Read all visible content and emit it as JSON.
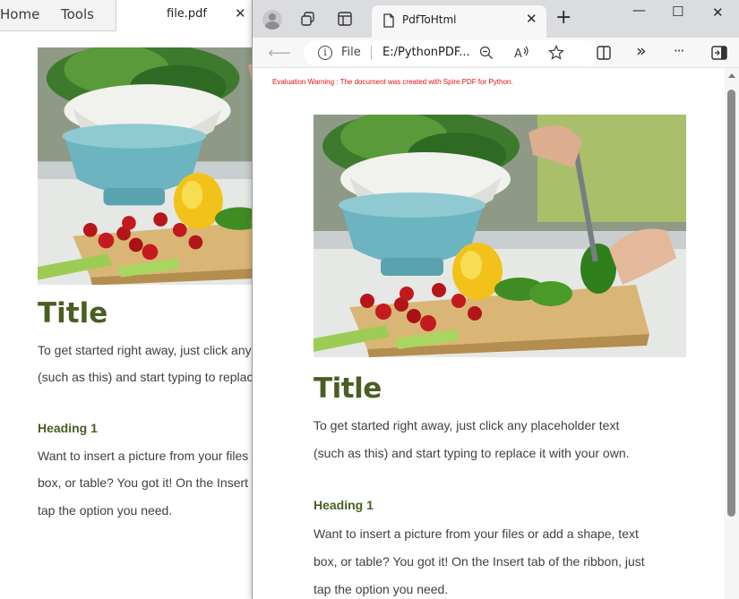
{
  "background_viewer": {
    "tabs": {
      "home": "Home",
      "tools": "Tools"
    },
    "file_tab": {
      "name": "file.pdf",
      "close": "✕"
    },
    "document": {
      "title": "Title",
      "line1": "To get started right away, just click any placeholder text",
      "line2": "(such as this) and start typing to replace it with your own.",
      "heading": "Heading 1",
      "line3": "Want to insert a picture from your files or add a shape, text",
      "line4": "box, or table? You got it! On the Insert tab of the ribbon, just",
      "line5": "tap the option you need."
    }
  },
  "browser": {
    "tab": {
      "title": "PdfToHtml",
      "close": "✕"
    },
    "new_tab": "+",
    "window_controls": {
      "minimize": "—",
      "maximize": "☐",
      "close": "✕"
    },
    "address_bar": {
      "scheme_label": "File",
      "url": "E:/PythonPDF...",
      "more": "···",
      "overflow": "»"
    },
    "page": {
      "evaluation_warning": "Evaluation Warning : The document was created with Spire.PDF for Python.",
      "title": "Title",
      "line1": "To get started right away, just click any placeholder text",
      "line2": "(such as this) and start typing to replace it with your own.",
      "heading": "Heading 1",
      "line3": "Want to insert a picture from your files or add a shape, text",
      "line4": "box, or table? You got it! On the Insert tab of the ribbon, just",
      "line5": "tap the option you need."
    }
  },
  "colors": {
    "heading_green": "#4a5e23",
    "warning_red": "#e01010",
    "titlebar": "#dadcdf"
  },
  "icons": [
    "profile-avatar",
    "workspaces-icon",
    "tab-actions-icon",
    "page-icon",
    "back-arrow-icon",
    "info-icon",
    "zoom-icon",
    "read-aloud-icon",
    "favorite-star-icon",
    "split-screen-icon",
    "more-tools-icon",
    "menu-icon",
    "sidebar-icon"
  ]
}
